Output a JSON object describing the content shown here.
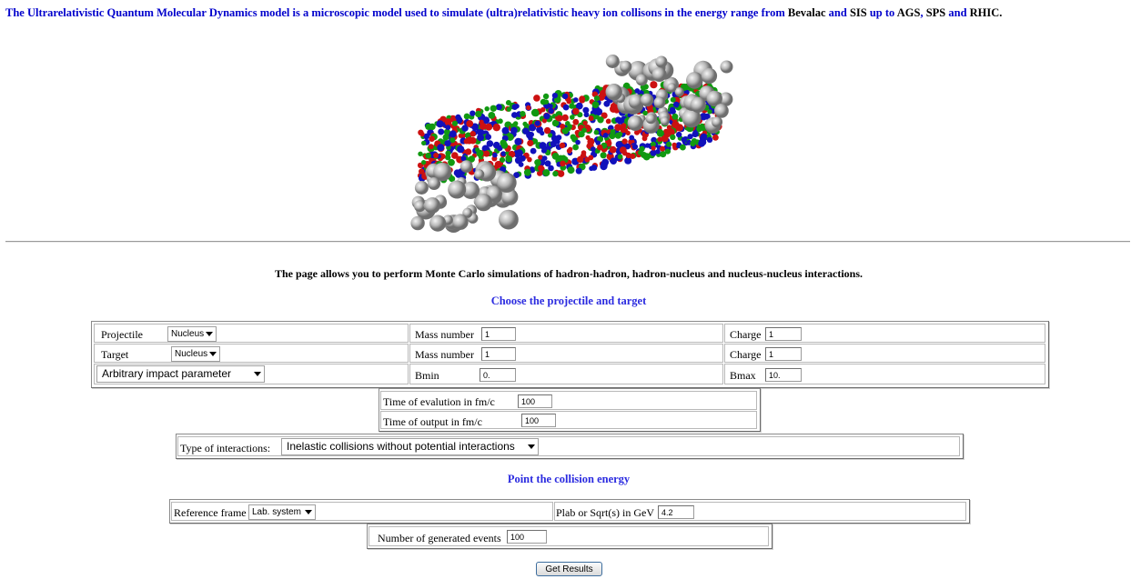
{
  "intro": {
    "text_a": "The Ultrarelativistic Quantum Molecular Dynamics model is a microscopic model used to simulate (ultra)relativistic heavy ion collisons in the energy range from ",
    "bevalac": "Bevalac",
    "and1": " and ",
    "sis": "SIS",
    "upto": " up to ",
    "ags": "AGS",
    "comma": ", ",
    "sps": "SPS",
    "and2": " and ",
    "rhic": "RHIC."
  },
  "description": "The page allows you to perform Monte Carlo simulations of  hadron-hadron, hadron-nucleus and nucleus-nucleus interactions.",
  "section1_heading": "Choose the projectile and target",
  "projectile": {
    "label": "Projectile",
    "selected": "Nucleus",
    "mass_label": "Mass number",
    "mass_value": "1",
    "charge_label": "Charge",
    "charge_value": "1"
  },
  "target": {
    "label": "Target",
    "selected": "Nucleus",
    "mass_label": "Mass number",
    "mass_value": "1",
    "charge_label": "Charge",
    "charge_value": "1"
  },
  "impact": {
    "selected": "Arbitrary impact parameter",
    "bmin_label": "Bmin",
    "bmin_value": "0.",
    "bmax_label": "Bmax",
    "bmax_value": "10."
  },
  "time": {
    "evolution_label": "Time of evalution in fm/c",
    "evolution_value": "100",
    "output_label": "Time of output in fm/c",
    "output_value": "100"
  },
  "interactions": {
    "label": "Type of interactions:",
    "selected": "Inelastic collisions without potential interactions"
  },
  "section2_heading": "Point the collision energy",
  "energy": {
    "frame_label": "Reference frame",
    "frame_selected": "Lab. system",
    "plab_label": "Plab or Sqrt(s) in GeV",
    "plab_value": "4.2"
  },
  "events": {
    "label": "Number of generated events",
    "value": "100"
  },
  "submit_label": "Get Results",
  "colors": {
    "accent": "#2b2be0",
    "link_blue": "#0000cc",
    "particle_red": "#cc1111",
    "particle_green": "#119911",
    "particle_blue": "#1111bb",
    "nucleon_gray": "#b8b8b8"
  }
}
